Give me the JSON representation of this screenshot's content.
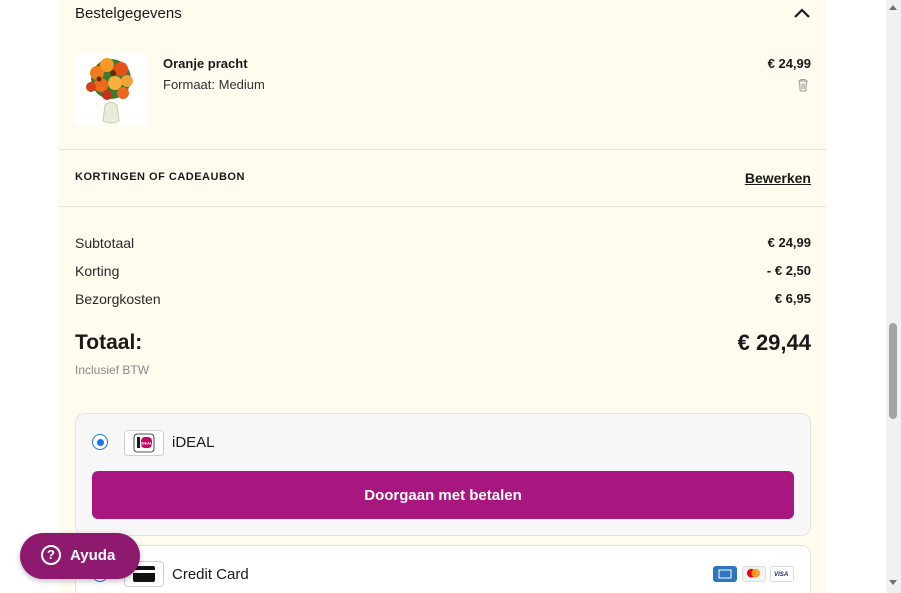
{
  "order": {
    "section_title": "Bestelgegevens",
    "item": {
      "name": "Oranje pracht",
      "size": "Formaat: Medium",
      "price": "€ 24,99"
    },
    "discount": {
      "label": "KORTINGEN OF CADEAUBON",
      "edit_label": "Bewerken"
    },
    "summary": [
      {
        "label": "Subtotaal",
        "value": "€ 24,99"
      },
      {
        "label": "Korting",
        "value": "- € 2,50"
      },
      {
        "label": "Bezorgkosten",
        "value": "€ 6,95"
      }
    ],
    "total_label": "Totaal:",
    "total_value": "€ 29,44",
    "vat_note": "Inclusief BTW"
  },
  "payment": {
    "methods": [
      {
        "label": "iDEAL",
        "selected": true,
        "logo_text": "iDEAL"
      },
      {
        "label": "Credit Card",
        "selected": false
      }
    ],
    "continue_label": "Doorgaan met betalen",
    "card_brands": [
      "AMEX",
      "Mastercard",
      "VISA"
    ]
  },
  "help": {
    "label": "Ayuda"
  },
  "colors": {
    "panel_bg": "#fffbef",
    "accent": "#a8177f",
    "help_bg": "#8e1a6f",
    "radio": "#1a73e8"
  }
}
